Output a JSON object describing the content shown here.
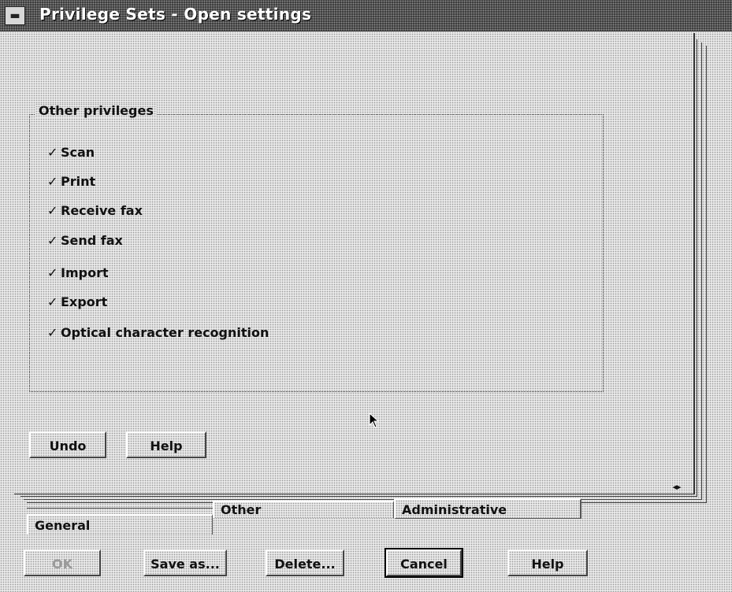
{
  "window": {
    "title": "Privilege Sets - Open settings",
    "sysmenu_icon": "system-menu-icon"
  },
  "group": {
    "label": "Other privileges",
    "items": [
      {
        "label": "Scan",
        "checked": true
      },
      {
        "label": "Print",
        "checked": true
      },
      {
        "label": "Receive fax",
        "checked": true
      },
      {
        "label": "Send fax",
        "checked": true
      },
      {
        "label": "Import",
        "checked": true
      },
      {
        "label": "Export",
        "checked": true
      },
      {
        "label": "Optical character recognition",
        "checked": true
      }
    ],
    "check_glyph": "✓"
  },
  "page_buttons": {
    "undo": "Undo",
    "help": "Help"
  },
  "page_arrows": "◂▸",
  "tabs": {
    "general": "General",
    "other": "Other",
    "administrative": "Administrative"
  },
  "dialog_buttons": {
    "ok": "OK",
    "save_as": "Save as...",
    "delete": "Delete...",
    "cancel": "Cancel",
    "help": "Help"
  }
}
